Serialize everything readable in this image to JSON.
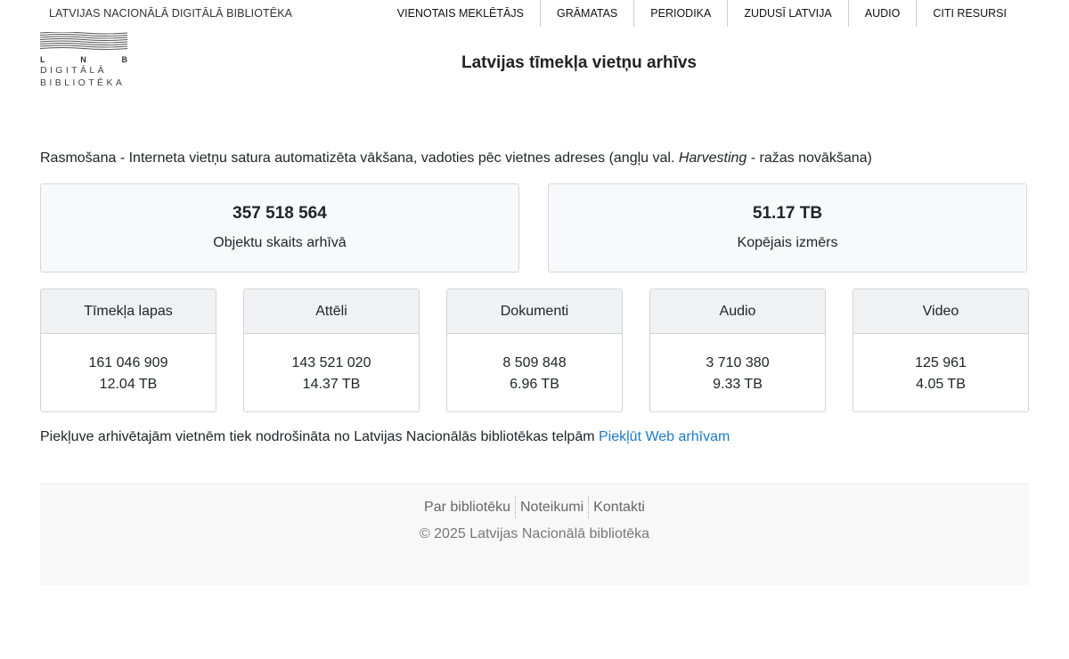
{
  "header": {
    "site_name": "LATVIJAS NACIONĀLĀ DIGITĀLĀ BIBLIOTĒKA",
    "nav": [
      "VIENOTAIS MEKLĒTĀJS",
      "GRĀMATAS",
      "PERIODIKA",
      "ZUDUSĪ LATVIJA",
      "AUDIO",
      "CITI RESURSI"
    ]
  },
  "logo": {
    "letters": [
      "L",
      "N",
      "B"
    ],
    "line1": "DIGITĀLĀ",
    "line2": "BIBLIOTĒKA",
    "icon": "waves-logo-icon"
  },
  "main": {
    "title": "Latvijas tīmekļa vietņu arhīvs",
    "intro_before": "Rasmošana - Interneta vietņu satura automatizēta vākšana, vadoties pēc vietnes adreses (angļu val. ",
    "intro_italic": "Harvesting",
    "intro_after": " - ražas novākšana)",
    "stats": [
      {
        "value": "357 518 564",
        "label": "Objektu skaits arhīvā"
      },
      {
        "value": "51.17 TB",
        "label": "Kopējais izmērs"
      }
    ],
    "types": [
      {
        "name": "Tīmekļa lapas",
        "count": "161 046 909",
        "size": "12.04 TB"
      },
      {
        "name": "Attēli",
        "count": "143 521 020",
        "size": "14.37 TB"
      },
      {
        "name": "Dokumenti",
        "count": "8 509 848",
        "size": "6.96 TB"
      },
      {
        "name": "Audio",
        "count": "3 710 380",
        "size": "9.33 TB"
      },
      {
        "name": "Video",
        "count": "125 961",
        "size": "4.05 TB"
      }
    ],
    "access_text": "Piekļuve arhivētajām vietnēm tiek nodrošināta no Latvijas Nacionālās bibliotēkas telpām ",
    "access_link": "Piekļūt Web arhīvam",
    "link_color": "#1a7bc8"
  },
  "footer": {
    "links": [
      "Par bibliotēku",
      "Noteikumi",
      "Kontakti"
    ],
    "copyright": "© 2025 Latvijas Nacionālā bibliotēka"
  }
}
